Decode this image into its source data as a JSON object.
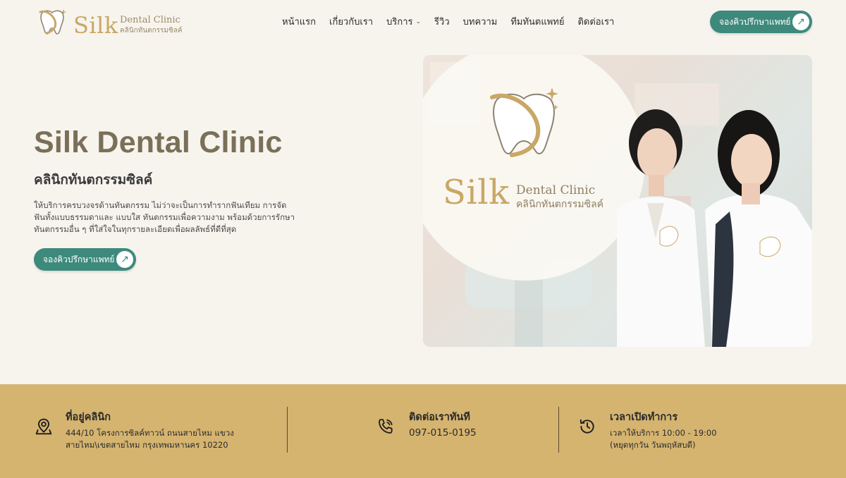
{
  "brand": {
    "logo_word": "Silk",
    "logo_subtitle": "Dental Clinic",
    "logo_thai": "คลินิกทันตกรรมซิลค์"
  },
  "nav": {
    "items": [
      {
        "label": "หน้าแรก"
      },
      {
        "label": "เกี่ยวกับเรา"
      },
      {
        "label": "บริการ",
        "has_dropdown": true
      },
      {
        "label": "รีวิว"
      },
      {
        "label": "บทความ"
      },
      {
        "label": "ทีมทันตแพทย์"
      },
      {
        "label": "ติดต่อเรา"
      }
    ],
    "cta_label": "จองคิวปรึกษาแพทย์"
  },
  "hero": {
    "title": "Silk Dental Clinic",
    "subtitle": "คลินิกทันตกรรมซิลค์",
    "description": "ให้บริการครบวงจรด้านทันตกรรม ไม่ว่าจะเป็นการทำรากฟันเทียม การจัดฟันทั้งแบบธรรมดาและ แบบใส ทันตกรรมเพื่อความงาม พร้อมด้วยการรักษาทันตกรรมอื่น ๆ ที่ใส่ใจในทุกรายละเอียดเพื่อผลลัพธ์ที่ดีที่สุด",
    "cta_label": "จองคิวปรึกษาแพทย์",
    "image": {
      "logo_word": "Silk",
      "logo_subtitle": "Dental Clinic",
      "logo_thai": "คลินิกทันตกรรมซิลค์"
    }
  },
  "info": {
    "address": {
      "icon": "map-pin-icon",
      "title": "ที่อยู่คลินิก",
      "line1": "444/10 โครงการซิลค์ทาวน์ ถนนสายไหม แขวง",
      "line2": "สายไหม\\เขตสายไหม กรุงเทพมหานคร 10220"
    },
    "contact": {
      "icon": "phone-icon",
      "title": "ติดต่อเราทันที",
      "phone": "097-015-0195"
    },
    "hours": {
      "icon": "history-clock-icon",
      "title": "เวลาเปิดทำการ",
      "line1": "เวลาให้บริการ 10:00 - 19:00",
      "line2": "(หยุดทุกวัน วันพฤหัสบดี)"
    }
  },
  "colors": {
    "background": "#f7f4ee",
    "accent_teal": "#3d8a7d",
    "gold": "#c9a765",
    "title_olive": "#7a7058",
    "info_bar": "#d5b470"
  }
}
